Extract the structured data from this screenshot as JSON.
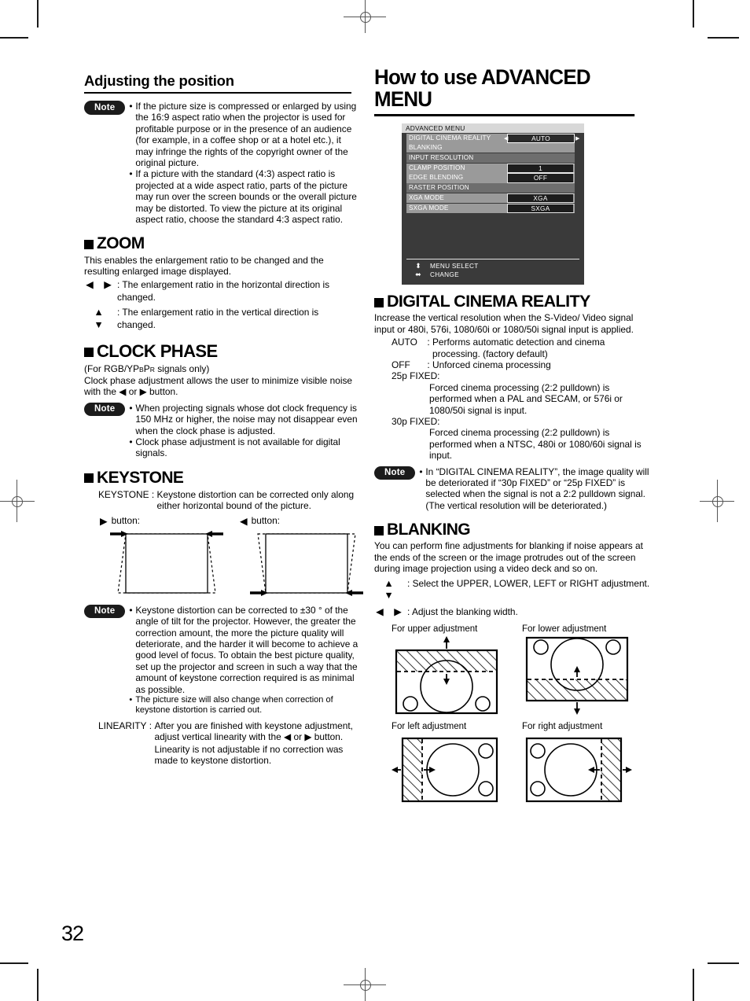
{
  "page": {
    "number": "32"
  },
  "left": {
    "heading": "Adjusting the position",
    "note1": {
      "label": "Note",
      "bullets": [
        "If the picture size is compressed or enlarged by using the 16:9 aspect ratio when the projector is used for profitable purpose or in the presence of an audience (for example, in a coffee shop or at a hotel etc.), it may infringe the rights of the copyright owner of the original picture.",
        "If a picture with the standard (4:3) aspect ratio is projected at a wide aspect ratio, parts of the picture may run over the screen bounds or the overall picture may be distorted. To view the picture at its original aspect ratio, choose the standard 4:3 aspect ratio."
      ]
    },
    "zoom": {
      "title": "ZOOM",
      "intro": "This enables the enlargement ratio to be changed and the resulting enlarged image displayed.",
      "rows": [
        {
          "arrows": "◀ ▶",
          "text": "The enlargement ratio in the horizontal direction is changed."
        },
        {
          "arrows": "▲ ▼",
          "text": "The enlargement ratio in the vertical direction is changed."
        }
      ]
    },
    "clock_phase": {
      "title": "CLOCK PHASE",
      "line1_a": "(For RGB/YP",
      "line1_b": "B",
      "line1_c": "P",
      "line1_d": "R",
      "line1_e": " signals only)",
      "line2": "Clock phase adjustment allows the user to minimize visible noise with the ◀ or ▶ button.",
      "note_label": "Note",
      "note_bullets": [
        "When projecting signals whose dot clock frequency is 150 MHz or higher, the noise may not disappear even when the clock phase is adjusted.",
        "Clock phase adjustment is not available for digital signals."
      ]
    },
    "keystone": {
      "title": "KEYSTONE",
      "def_label": "KEYSTONE",
      "def_text": "Keystone distortion can be corrected only along either horizontal bound of the picture.",
      "fig_left_caption": "button:",
      "fig_left_arrow": "▶",
      "fig_right_caption": "button:",
      "fig_right_arrow": "◀",
      "note_label": "Note",
      "note_bullets": [
        "Keystone distortion can be corrected to ±30 ° of the angle of tilt for the projector. However, the greater the correction amount, the more the picture quality will deteriorate, and the harder it will become to achieve a good level of focus. To obtain the best picture quality, set up the projector and screen in such a way that the amount of keystone correction required is as minimal as possible.",
        "The picture size will also change when correction of keystone distortion is carried out."
      ],
      "linearity_label": "LINEARITY",
      "linearity_text": "After you are finished with keystone adjustment, adjust vertical linearity with the ◀ or ▶ button.",
      "linearity_text2": "Linearity is not adjustable if no correction was made to keystone distortion."
    }
  },
  "right": {
    "heading": "How to use ADVANCED MENU",
    "osd": {
      "title": "ADVANCED MENU",
      "rows": [
        {
          "name": "DIGITAL CINEMA REALITY",
          "value": "AUTO",
          "style": "selected"
        },
        {
          "name": "BLANKING",
          "value": "",
          "style": "light"
        },
        {
          "name": "INPUT RESOLUTION",
          "value": "",
          "style": "dark"
        },
        {
          "name": "CLAMP POSITION",
          "value": "1",
          "style": "value"
        },
        {
          "name": "EDGE BLENDING",
          "value": "OFF",
          "style": "value"
        },
        {
          "name": "RASTER POSITION",
          "value": "",
          "style": "dark"
        },
        {
          "name": "XGA MODE",
          "value": "XGA",
          "style": "value"
        },
        {
          "name": "SXGA MODE",
          "value": "SXGA",
          "style": "value"
        }
      ],
      "footer": [
        {
          "icon": "⬍",
          "label": "MENU SELECT"
        },
        {
          "icon": "⬌",
          "label": "CHANGE"
        }
      ]
    },
    "dcr": {
      "title": "DIGITAL CINEMA REALITY",
      "intro": "Increase the vertical resolution when the S-Video/ Video signal input or 480i, 576i, 1080/60i or 1080/50i signal input is applied.",
      "options": [
        {
          "label": "AUTO",
          "sep": ":",
          "text": "Performs automatic detection and cinema processing. (factory default)"
        },
        {
          "label": "OFF",
          "sep": ":",
          "text": "Unforced cinema processing"
        }
      ],
      "fixed": [
        {
          "label": "25p FIXED:",
          "text": "Forced cinema processing (2:2 pulldown) is performed when a PAL and SECAM, or 576i or 1080/50i signal is input."
        },
        {
          "label": "30p FIXED:",
          "text": "Forced cinema processing (2:2 pulldown) is performed when a NTSC, 480i or 1080/60i signal is input."
        }
      ],
      "note_label": "Note",
      "note_bullets": [
        "In “DIGITAL CINEMA REALITY”, the image quality will be deteriorated if “30p FIXED” or “25p FIXED” is selected when the signal is not a 2:2 pulldown signal. (The vertical resolution will be deteriorated.)"
      ]
    },
    "blanking": {
      "title": "BLANKING",
      "intro": "You can perform fine adjustments for blanking if noise appears at the ends of the screen or the image protrudes out of the screen during image projection using a video deck and so on.",
      "rows": [
        {
          "arrows": "▲ ▼",
          "text": "Select the UPPER, LOWER, LEFT or RIGHT adjustment."
        },
        {
          "arrows": "◀ ▶",
          "text": "Adjust the blanking width."
        }
      ],
      "figures": [
        {
          "caption": "For upper adjustment"
        },
        {
          "caption": "For lower adjustment"
        },
        {
          "caption": "For left adjustment"
        },
        {
          "caption": "For right adjustment"
        }
      ]
    }
  }
}
